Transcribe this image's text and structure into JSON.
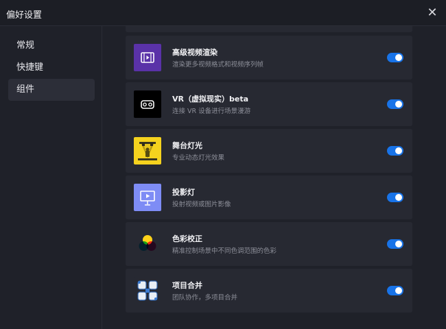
{
  "window": {
    "title": "偏好设置",
    "close_symbol": "✕"
  },
  "sidebar": {
    "items": [
      {
        "label": "常规",
        "active": false
      },
      {
        "label": "快捷键",
        "active": false
      },
      {
        "label": "组件",
        "active": true
      }
    ]
  },
  "plugins": [
    {
      "title": "高级视频渲染",
      "description": "渲染更多视频格式和视频序列帧",
      "enabled": true,
      "icon": "film-icon",
      "color": "#5a32a8"
    },
    {
      "title": "VR（虚拟现实）beta",
      "description": "连接 VR 设备进行场景漫游",
      "enabled": true,
      "icon": "vr-headset-icon",
      "color": "#000000"
    },
    {
      "title": "舞台灯光",
      "description": "专业动态灯光效果",
      "enabled": true,
      "icon": "stage-light-icon",
      "color": "#f5d21e"
    },
    {
      "title": "投影灯",
      "description": "投射视频或图片影像",
      "enabled": true,
      "icon": "projector-icon",
      "color": "#7e8cf5"
    },
    {
      "title": "色彩校正",
      "description": "精准控制场景中不同色调范围的色彩",
      "enabled": true,
      "icon": "color-circles-icon",
      "color": "#ffffff"
    },
    {
      "title": "项目合并",
      "description": "团队协作，多项目合并",
      "enabled": true,
      "icon": "team-hands-icon",
      "color": "#3a7ad1"
    }
  ],
  "colors": {
    "background": "#1f2129",
    "card": "#272932",
    "toggle_on": "#1873e8",
    "text_secondary": "#8d8f99"
  }
}
